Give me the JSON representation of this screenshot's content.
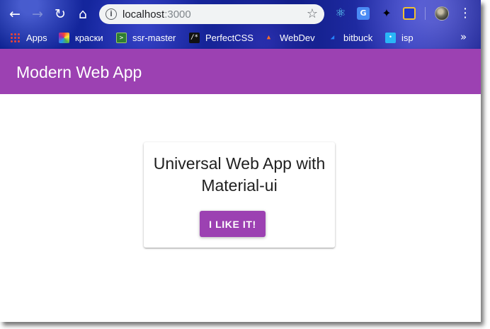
{
  "browser": {
    "url_host": "localhost",
    "url_port": ":3000",
    "icons": {
      "back": "arrow-left-icon",
      "forward": "arrow-right-icon",
      "reload": "reload-icon",
      "home": "home-icon",
      "info": "info-icon",
      "bookmark": "star-icon",
      "menu": "kebab-menu-icon"
    },
    "extensions": [
      "react-devtools-icon",
      "google-translate-icon",
      "ninja-extension-icon",
      "bars-extension-icon"
    ],
    "bookmarks": [
      {
        "label": "Apps",
        "icon": "apps-grid-icon"
      },
      {
        "label": "краски",
        "icon": "color-wheel-icon"
      },
      {
        "label": "ssr-master",
        "icon": "terminal-icon"
      },
      {
        "label": "PerfectCSS",
        "icon": "code-comment-icon"
      },
      {
        "label": "WebDev",
        "icon": "gitlab-icon"
      },
      {
        "label": "bitbuck",
        "icon": "bitbucket-icon"
      },
      {
        "label": "isp",
        "icon": "globe-icon"
      }
    ],
    "more_bookmarks": "»"
  },
  "app": {
    "title": "Modern Web App",
    "accent_color": "#9c41b2",
    "card_text": "Universal Web App with Material-ui",
    "button_label": "I like it!"
  }
}
